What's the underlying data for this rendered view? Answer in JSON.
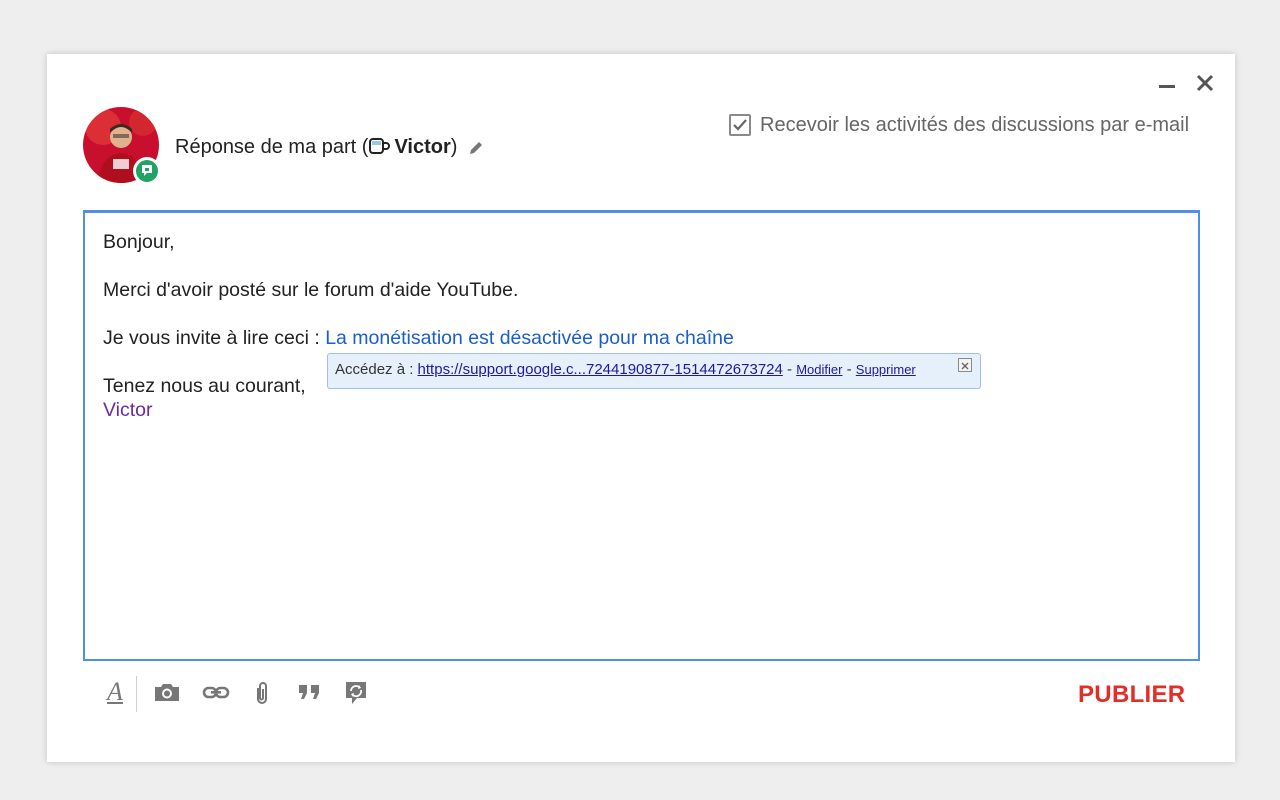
{
  "header": {
    "reply_prefix": "Réponse de ma part (",
    "reply_name": "Victor",
    "reply_suffix": ")",
    "notify_checked": true,
    "notify_label": "Recevoir les activités des discussions par e-mail"
  },
  "editor": {
    "greeting": "Bonjour,",
    "thanks": "Merci d'avoir posté sur le forum d'aide YouTube.",
    "invite_text": "Je vous invite à lire ceci : ",
    "invite_link": "La monétisation est désactivée pour ma chaîne",
    "closing": "Tenez nous au courant,",
    "signature": "Victor"
  },
  "link_popup": {
    "prefix": "Accédez à : ",
    "url": "https://support.google.c...7244190877-1514472673724",
    "sep1": " - ",
    "edit": "Modifier",
    "sep2": " - ",
    "remove": "Supprimer"
  },
  "toolbar": {
    "icons": [
      "format-text-icon",
      "camera-icon",
      "link-icon",
      "attachment-icon",
      "quote-icon",
      "hangouts-icon"
    ],
    "publish_label": "PUBLIER"
  },
  "colors": {
    "link": "#1a5ecc",
    "signature": "#6a2aa8",
    "publish": "#e52d27",
    "editor_border": "#4f8fe6",
    "badge": "#1fa463"
  }
}
